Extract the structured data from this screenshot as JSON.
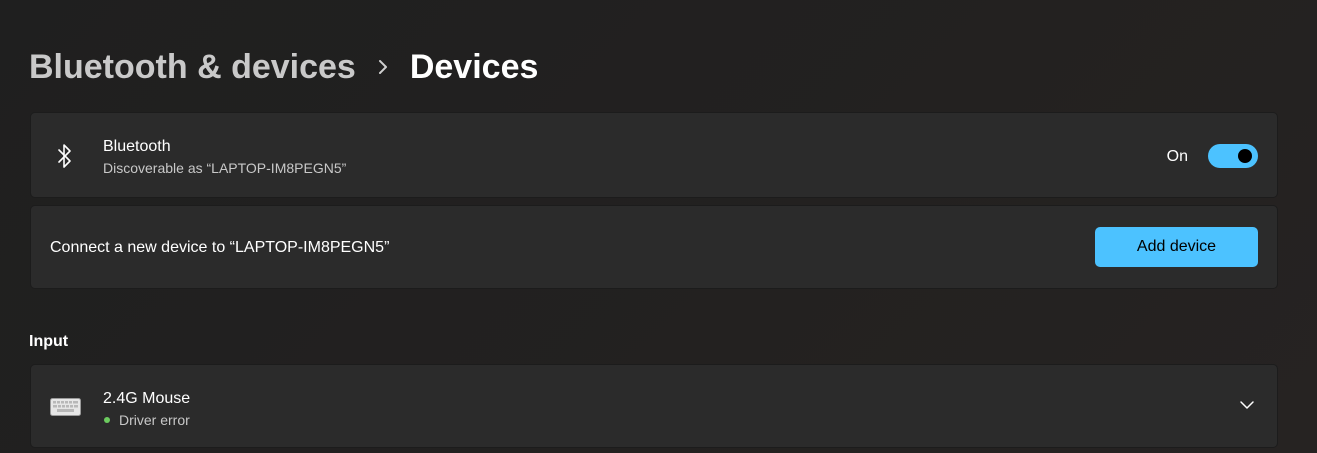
{
  "breadcrumb": {
    "parent": "Bluetooth & devices",
    "separator_icon": "chevron-right-icon",
    "current": "Devices"
  },
  "bluetooth": {
    "icon": "bluetooth-icon",
    "title": "Bluetooth",
    "subtitle": "Discoverable as “LAPTOP-IM8PEGN5”",
    "toggle_label": "On",
    "toggle_state": true
  },
  "add_device": {
    "text": "Connect a new device to “LAPTOP-IM8PEGN5”",
    "button_label": "Add device"
  },
  "input_section": {
    "heading": "Input",
    "devices": [
      {
        "icon": "keyboard-icon",
        "name": "2.4G Mouse",
        "status": "Driver error",
        "status_color": "#6ccb5f",
        "expand_icon": "chevron-down-icon"
      }
    ]
  },
  "colors": {
    "accent": "#4cc2ff",
    "background": "#202020",
    "card": "#2b2b2b"
  }
}
